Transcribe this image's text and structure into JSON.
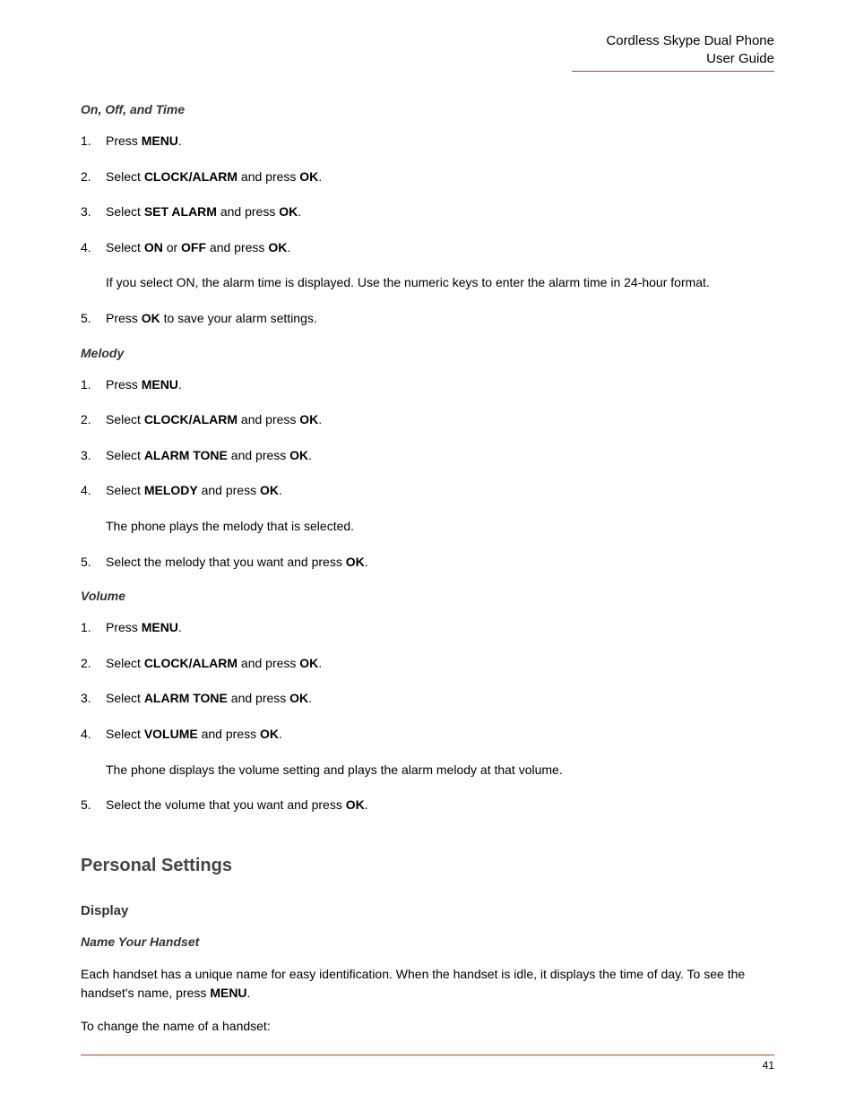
{
  "header": {
    "line1": "Cordless Skype Dual Phone",
    "line2": "User Guide"
  },
  "sections": {
    "onOffTime": {
      "title": "On, Off, and Time",
      "step1_a": "Press ",
      "step1_b": "MENU",
      "step1_c": ".",
      "step2_a": "Select ",
      "step2_b": "CLOCK/ALARM",
      "step2_c": " and press ",
      "step2_d": "OK",
      "step2_e": ".",
      "step3_a": "Select ",
      "step3_b": "SET ALARM",
      "step3_c": " and press ",
      "step3_d": "OK",
      "step3_e": ".",
      "step4_a": "Select ",
      "step4_b": "ON",
      "step4_c": " or ",
      "step4_d": "OFF",
      "step4_e": " and press ",
      "step4_f": "OK",
      "step4_g": ".",
      "note": "If you select ON, the alarm time is displayed. Use the numeric keys to enter the alarm time in 24-hour format.",
      "step5_a": "Press ",
      "step5_b": "OK",
      "step5_c": " to save your alarm settings."
    },
    "melody": {
      "title": "Melody",
      "step1_a": "Press ",
      "step1_b": "MENU",
      "step1_c": ".",
      "step2_a": "Select ",
      "step2_b": "CLOCK/ALARM",
      "step2_c": " and press ",
      "step2_d": "OK",
      "step2_e": ".",
      "step3_a": "Select ",
      "step3_b": "ALARM TONE",
      "step3_c": " and press ",
      "step3_d": "OK",
      "step3_e": ".",
      "step4_a": "Select ",
      "step4_b": "MELODY",
      "step4_c": " and press ",
      "step4_d": "OK",
      "step4_e": ".",
      "note": "The phone plays the melody that is selected.",
      "step5_a": "Select the melody that you want and press ",
      "step5_b": "OK",
      "step5_c": "."
    },
    "volume": {
      "title": "Volume",
      "step1_a": "Press ",
      "step1_b": "MENU",
      "step1_c": ".",
      "step2_a": "Select ",
      "step2_b": "CLOCK/ALARM",
      "step2_c": " and press ",
      "step2_d": "OK",
      "step2_e": ".",
      "step3_a": "Select ",
      "step3_b": "ALARM TONE",
      "step3_c": " and press ",
      "step3_d": "OK",
      "step3_e": ".",
      "step4_a": "Select ",
      "step4_b": "VOLUME",
      "step4_c": " and press ",
      "step4_d": "OK",
      "step4_e": ".",
      "note": "The phone displays the volume setting and plays the alarm melody at that volume.",
      "step5_a": "Select the volume that you want and press ",
      "step5_b": "OK",
      "step5_c": "."
    }
  },
  "personal": {
    "heading": "Personal Settings",
    "display": "Display",
    "nameHandset": {
      "title": "Name Your Handset",
      "para_a": "Each handset has a unique name for easy identification. When the handset is idle, it displays the time of day. To see the handset's name, press ",
      "para_b": "MENU",
      "para_c": ".",
      "para2": "To change the name of a handset:"
    }
  },
  "pageNumber": "41"
}
